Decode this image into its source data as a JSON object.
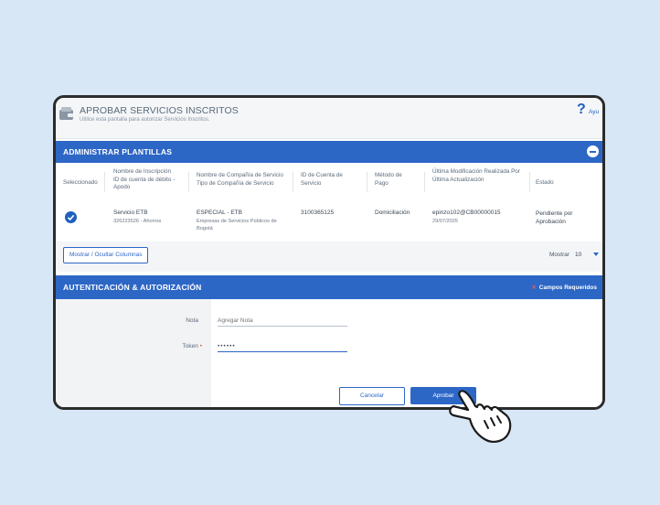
{
  "header": {
    "title": "APROBAR SERVICIOS INSCRITOS",
    "subtitle": "Utilice esta pantalla para autorizar Servicios Inscritos.",
    "help_label": "Ayu"
  },
  "templates_section": {
    "title": "ADMINISTRAR PLANTILLAS",
    "columns": [
      {
        "line1": "Seleccionado",
        "line2": ""
      },
      {
        "line1": "Nombre de Inscripción",
        "line2": "ID de cuenta de débito - Apodo"
      },
      {
        "line1": "Nombre de Compañía de Servicio",
        "line2": "Tipo de Compañía de Servicio"
      },
      {
        "line1": "ID de Cuenta de Servicio",
        "line2": ""
      },
      {
        "line1": "Método de Pago",
        "line2": ""
      },
      {
        "line1": "Última Modificación Realizada Por",
        "line2": "Última Actualización"
      },
      {
        "line1": "Estado",
        "line2": ""
      }
    ],
    "rows": [
      {
        "selected": true,
        "enrollment_name": "Servicio ETB",
        "debit_account": "326223526 - Ahorros",
        "company_name": "ESPECIAL - ETB",
        "company_type": "Empresas de Servicios Públicos de Bogotá",
        "service_account_id": "3100365125",
        "payment_method": "Domiciliación",
        "modified_by": "epinzo102@CB00000015",
        "last_update": "29/07/2025",
        "status": "Pendiente por Aprobación"
      }
    ],
    "columns_button": "Mostrar / Ocultar Columnas",
    "show_label": "Mostrar",
    "show_value": "10"
  },
  "auth_section": {
    "title": "AUTENTICACIÓN & AUTORIZACIÓN",
    "required_label": "Campos Requeridos",
    "note_label": "Nota",
    "note_placeholder": "Agregar Nota",
    "token_label": "Token",
    "token_value": "••••••",
    "cancel_label": "Cancelar",
    "approve_label": "Aprobar"
  },
  "colors": {
    "accent": "#2d67c6",
    "page_background": "#d8e7f6",
    "required_marker": "#e05a5a"
  }
}
